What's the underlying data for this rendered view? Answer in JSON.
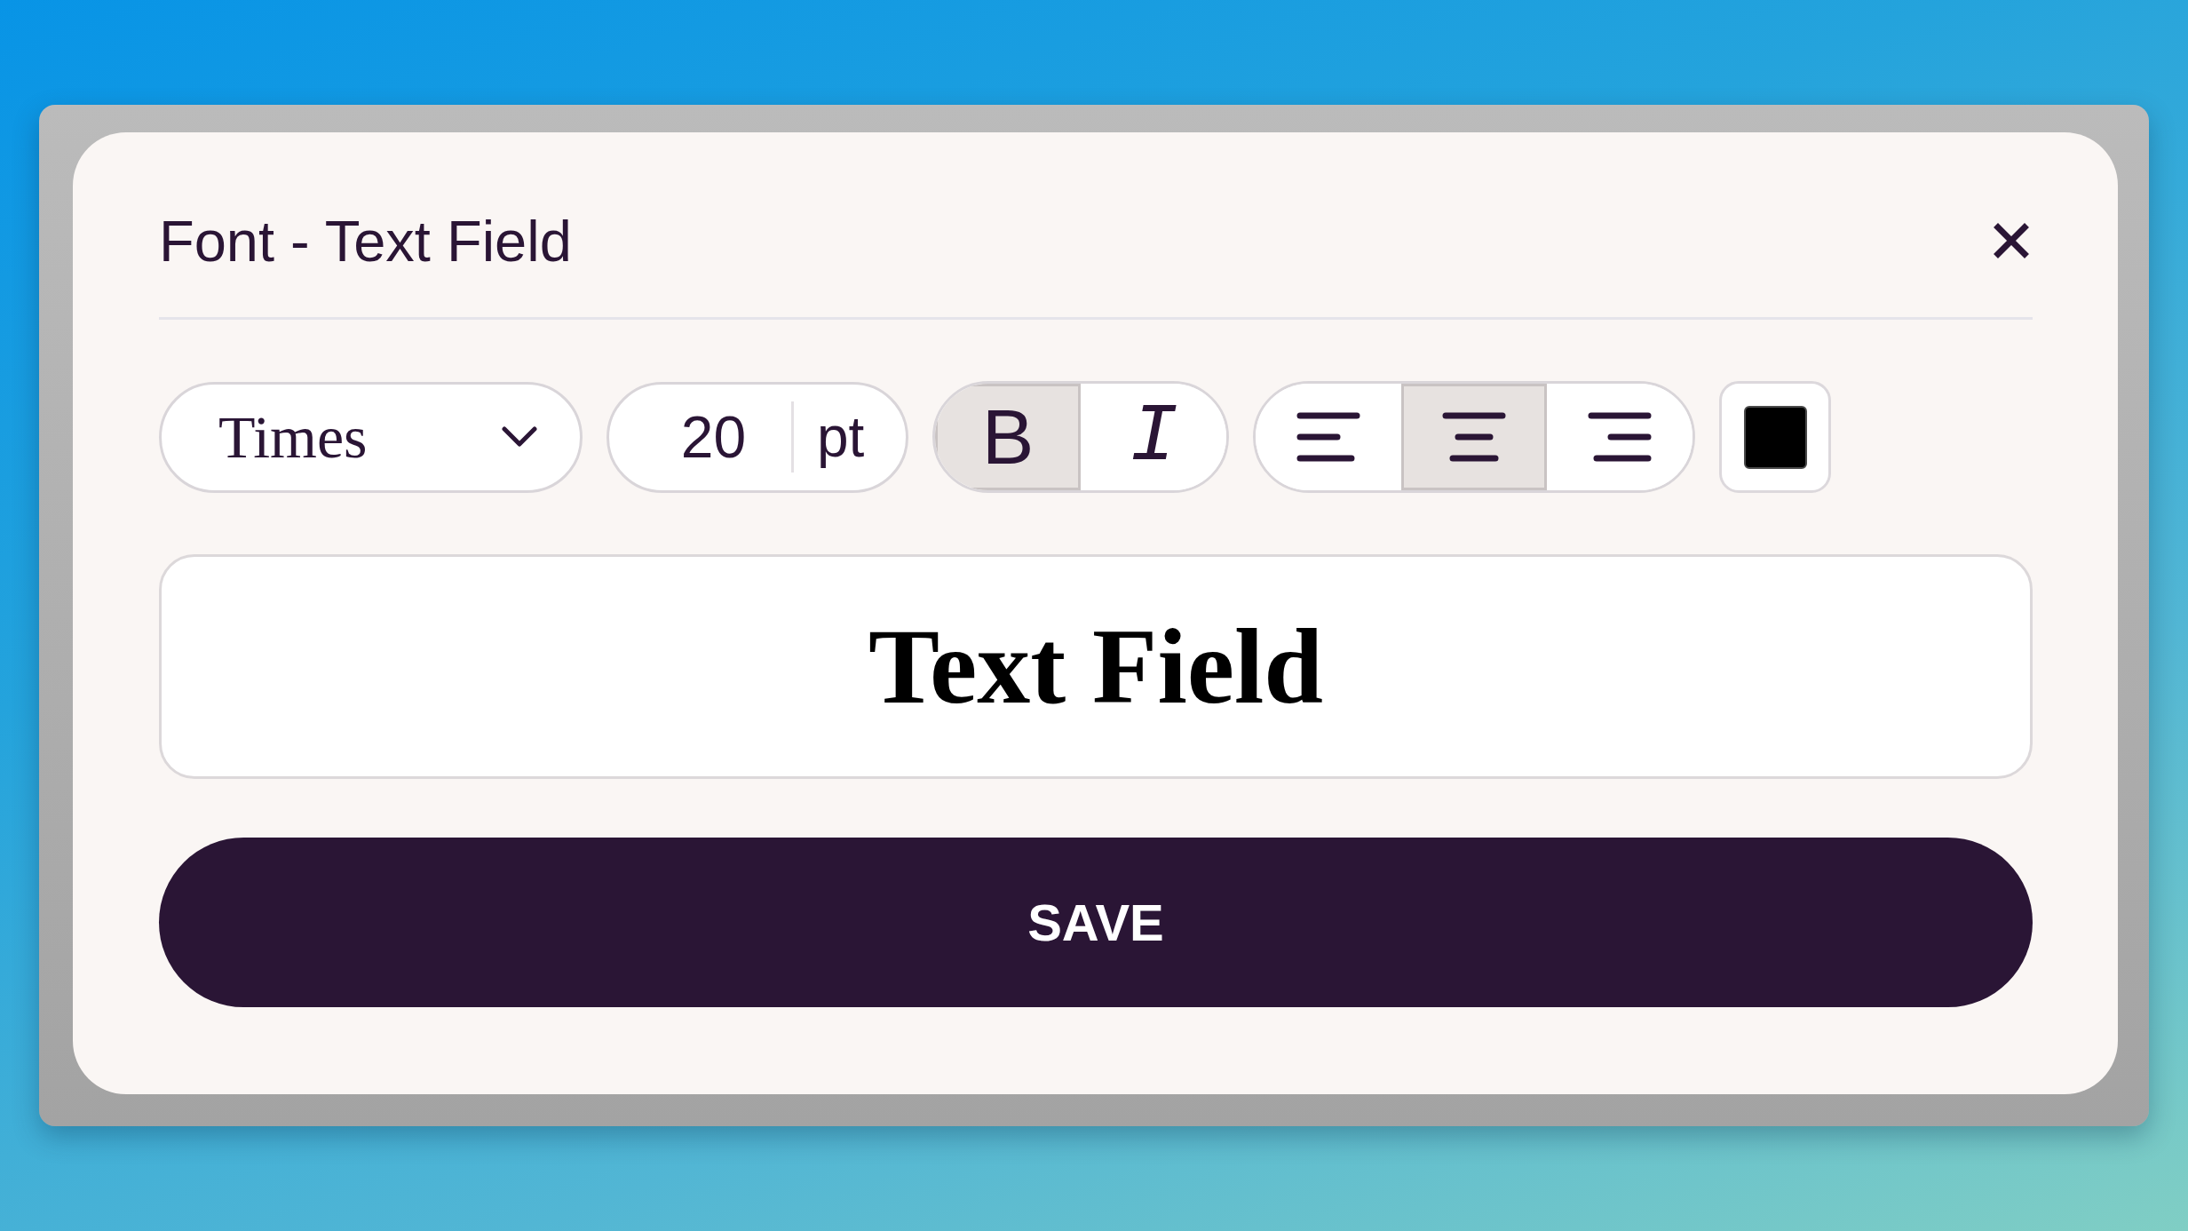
{
  "dialog": {
    "title": "Font - Text Field"
  },
  "font_family": {
    "value": "Times"
  },
  "font_size": {
    "value": "20",
    "unit": "pt"
  },
  "style_buttons": [
    {
      "kind": "bold",
      "label": "B",
      "selected": true
    },
    {
      "kind": "italic",
      "label": "I",
      "selected": false
    }
  ],
  "align_buttons": [
    {
      "kind": "left",
      "selected": false
    },
    {
      "kind": "center",
      "selected": true
    },
    {
      "kind": "right",
      "selected": false
    }
  ],
  "text_color": {
    "color": "#000000"
  },
  "preview": {
    "text": "Text Field"
  },
  "save_button": {
    "label": "SAVE"
  }
}
